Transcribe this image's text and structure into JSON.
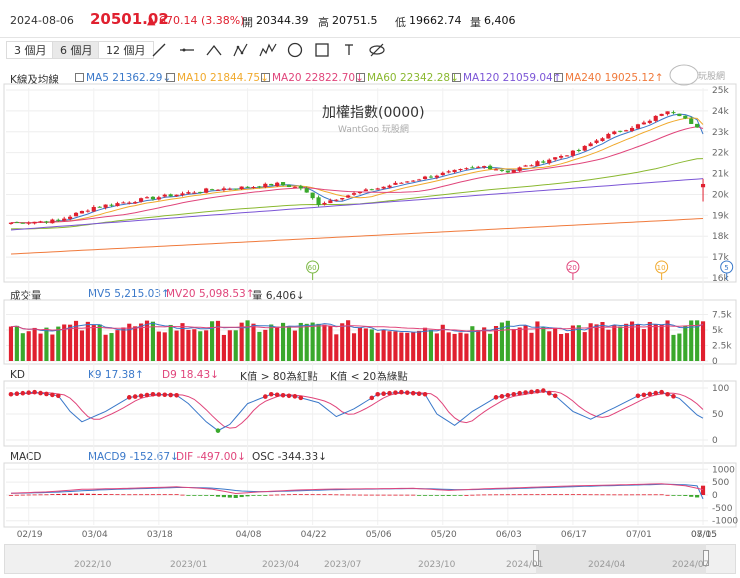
{
  "header": {
    "date": "2024-08-06",
    "price": "20501.02",
    "change": "▲ 670.14 (3.38%)",
    "open_label": "開",
    "open": "20344.39",
    "high_label": "高",
    "high": "20751.5",
    "low_label": "低",
    "low": "19662.74",
    "volume_label": "量",
    "volume": "6,406"
  },
  "toolbar": {
    "periods": [
      "3 個月",
      "6 個月",
      "12 個月"
    ],
    "active_period": "6 個月",
    "tools": [
      "line-tool-icon",
      "ray-tool-icon",
      "angle-tool-icon",
      "wave-abc-tool-icon",
      "wave-12345-tool-icon",
      "circle-tool-icon",
      "rectangle-tool-icon",
      "text-tool-icon",
      "hide-drawings-icon"
    ]
  },
  "price_panel": {
    "label": "K線及均線",
    "title": "加權指數(0000)",
    "watermark": "WantGoo 玩股網",
    "logo_text": "玩股網",
    "ma": [
      {
        "name": "MA5",
        "value": "21362.29",
        "arrow": "↓",
        "color": "#3a78c9"
      },
      {
        "name": "MA10",
        "value": "21844.75",
        "arrow": "↓",
        "color": "#f0a92c"
      },
      {
        "name": "MA20",
        "value": "22822.70",
        "arrow": "↓",
        "color": "#e0457b"
      },
      {
        "name": "MA60",
        "value": "22342.28",
        "arrow": "↓",
        "color": "#8ab830"
      },
      {
        "name": "MA120",
        "value": "21059.04",
        "arrow": "↑",
        "color": "#7b55d6"
      },
      {
        "name": "MA240",
        "value": "19025.12",
        "arrow": "↑",
        "color": "#f07a3c"
      }
    ],
    "markers": [
      {
        "text": "60",
        "color": "#7bb843",
        "date": "04/22"
      },
      {
        "text": "20",
        "color": "#e0457b",
        "date": "06/27"
      },
      {
        "text": "10",
        "color": "#f0a92c",
        "date": "07/19"
      },
      {
        "text": "5",
        "color": "#3a78c9",
        "date": "07/30"
      }
    ]
  },
  "volume_panel": {
    "label": "成交量",
    "mv5_label": "MV5",
    "mv5": "5,215.03",
    "mv5_arrow": "↑",
    "mv5_color": "#3a78c9",
    "mv20_label": "MV20",
    "mv20": "5,098.53",
    "mv20_arrow": "↑",
    "mv20_color": "#e0457b",
    "vol_label": "量",
    "vol": "6,406",
    "vol_arrow": "↓"
  },
  "kd_panel": {
    "label": "KD",
    "k_label": "K9",
    "k": "17.38",
    "k_arrow": "↑",
    "k_color": "#3a78c9",
    "d_label": "D9",
    "d": "18.43",
    "d_arrow": "↓",
    "d_color": "#e0457b",
    "note1": "K值 > 80為紅點",
    "note2": "K值 < 20為綠點"
  },
  "macd_panel": {
    "label": "MACD",
    "macd_label": "MACD9",
    "macd": "-152.67",
    "macd_arrow": "↓",
    "macd_color": "#3a78c9",
    "dif_label": "DIF",
    "dif": "-497.00",
    "dif_arrow": "↓",
    "dif_color": "#e0457b",
    "osc_label": "OSC",
    "osc": "-344.33",
    "osc_arrow": "↓"
  },
  "navigator": {
    "labels": [
      "2022/10",
      "2023/01",
      "2023/04",
      "2023/07",
      "2023/10",
      "2024/01",
      "2024/04",
      "2024/07"
    ]
  },
  "colors": {
    "up": "#e0202f",
    "down": "#3aa82c"
  },
  "chart_data": [
    {
      "type": "line",
      "title": "加權指數(0000)",
      "x_ticks": [
        "02/19",
        "03/04",
        "03/18",
        "04/08",
        "04/22",
        "05/06",
        "05/20",
        "06/03",
        "06/17",
        "07/01",
        "07/15",
        "08/05"
      ],
      "y_ticks": [
        16000,
        17000,
        18000,
        19000,
        20000,
        21000,
        22000,
        23000,
        24000,
        25000
      ],
      "y_tick_labels": [
        "16k",
        "17k",
        "18k",
        "19k",
        "20k",
        "21k",
        "22k",
        "23k",
        "24k",
        "25k"
      ],
      "ylim": [
        16000,
        25000
      ],
      "n_bars": 118,
      "close_anchors": [
        [
          0,
          18650
        ],
        [
          8,
          18750
        ],
        [
          14,
          19400
        ],
        [
          22,
          19750
        ],
        [
          28,
          20000
        ],
        [
          34,
          20250
        ],
        [
          40,
          20350
        ],
        [
          45,
          20500
        ],
        [
          49,
          20300
        ],
        [
          52,
          19550
        ],
        [
          56,
          19900
        ],
        [
          62,
          20300
        ],
        [
          68,
          20700
        ],
        [
          74,
          21050
        ],
        [
          80,
          21350
        ],
        [
          84,
          21100
        ],
        [
          90,
          21600
        ],
        [
          96,
          22100
        ],
        [
          100,
          22750
        ],
        [
          104,
          23150
        ],
        [
          108,
          23500
        ],
        [
          110,
          23900
        ],
        [
          112,
          23950
        ],
        [
          114,
          23700
        ],
        [
          116,
          23200
        ],
        [
          118,
          22900
        ],
        [
          120,
          22650
        ],
        [
          122,
          22800
        ],
        [
          124,
          22350
        ],
        [
          126,
          21900
        ],
        [
          127,
          20500
        ]
      ],
      "last_candle": {
        "open": 20344.39,
        "high": 20751.5,
        "low": 19662.74,
        "close": 20501.02
      },
      "series": [
        {
          "name": "MA5",
          "last": 21362.29
        },
        {
          "name": "MA10",
          "last": 21844.75
        },
        {
          "name": "MA20",
          "last": 22822.7
        },
        {
          "name": "MA60",
          "last": 22342.28
        },
        {
          "name": "MA120",
          "last": 21059.04
        },
        {
          "name": "MA240",
          "last": 19025.12
        }
      ]
    },
    {
      "type": "bar",
      "title": "成交量",
      "y_ticks": [
        0,
        2500,
        5000,
        7500
      ],
      "y_tick_labels": [
        "0",
        "2.5k",
        "5k",
        "7.5k"
      ],
      "ylim": [
        0,
        9200
      ],
      "last_value": 6406,
      "series": [
        {
          "name": "MV5",
          "last": 5215.03
        },
        {
          "name": "MV20",
          "last": 5098.53
        }
      ]
    },
    {
      "type": "line",
      "title": "KD",
      "y_ticks": [
        0,
        50,
        100
      ],
      "ylim": [
        0,
        100
      ],
      "k_anchors": [
        [
          0,
          88
        ],
        [
          4,
          92
        ],
        [
          8,
          85
        ],
        [
          10,
          55
        ],
        [
          12,
          35
        ],
        [
          16,
          55
        ],
        [
          20,
          82
        ],
        [
          24,
          88
        ],
        [
          28,
          86
        ],
        [
          30,
          70
        ],
        [
          33,
          35
        ],
        [
          35,
          18
        ],
        [
          37,
          30
        ],
        [
          40,
          70
        ],
        [
          44,
          88
        ],
        [
          48,
          84
        ],
        [
          52,
          72
        ],
        [
          55,
          45
        ],
        [
          58,
          60
        ],
        [
          62,
          88
        ],
        [
          66,
          92
        ],
        [
          70,
          88
        ],
        [
          72,
          50
        ],
        [
          75,
          28
        ],
        [
          78,
          55
        ],
        [
          82,
          82
        ],
        [
          86,
          90
        ],
        [
          90,
          95
        ],
        [
          92,
          85
        ],
        [
          95,
          55
        ],
        [
          98,
          40
        ],
        [
          102,
          62
        ],
        [
          106,
          85
        ],
        [
          110,
          92
        ],
        [
          113,
          80
        ],
        [
          116,
          48
        ],
        [
          119,
          30
        ],
        [
          122,
          18
        ],
        [
          125,
          15
        ],
        [
          127,
          17.38
        ]
      ],
      "series": [
        {
          "name": "K9",
          "last": 17.38
        },
        {
          "name": "D9",
          "last": 18.43
        }
      ]
    },
    {
      "type": "bar",
      "title": "MACD",
      "y_ticks": [
        -1000,
        -500,
        0,
        500,
        1000
      ],
      "ylim": [
        -1050,
        1050
      ],
      "dif_anchors": [
        [
          0,
          70
        ],
        [
          6,
          120
        ],
        [
          12,
          220
        ],
        [
          20,
          260
        ],
        [
          28,
          320
        ],
        [
          34,
          230
        ],
        [
          38,
          60
        ],
        [
          42,
          120
        ],
        [
          48,
          190
        ],
        [
          54,
          230
        ],
        [
          60,
          240
        ],
        [
          68,
          260
        ],
        [
          74,
          180
        ],
        [
          80,
          240
        ],
        [
          88,
          300
        ],
        [
          96,
          360
        ],
        [
          104,
          400
        ],
        [
          110,
          440
        ],
        [
          114,
          360
        ],
        [
          118,
          160
        ],
        [
          122,
          -120
        ],
        [
          125,
          -330
        ],
        [
          127,
          -497
        ]
      ],
      "series": [
        {
          "name": "MACD9",
          "last": -152.67
        },
        {
          "name": "DIF",
          "last": -497.0
        },
        {
          "name": "OSC",
          "last": -344.33
        }
      ]
    }
  ]
}
